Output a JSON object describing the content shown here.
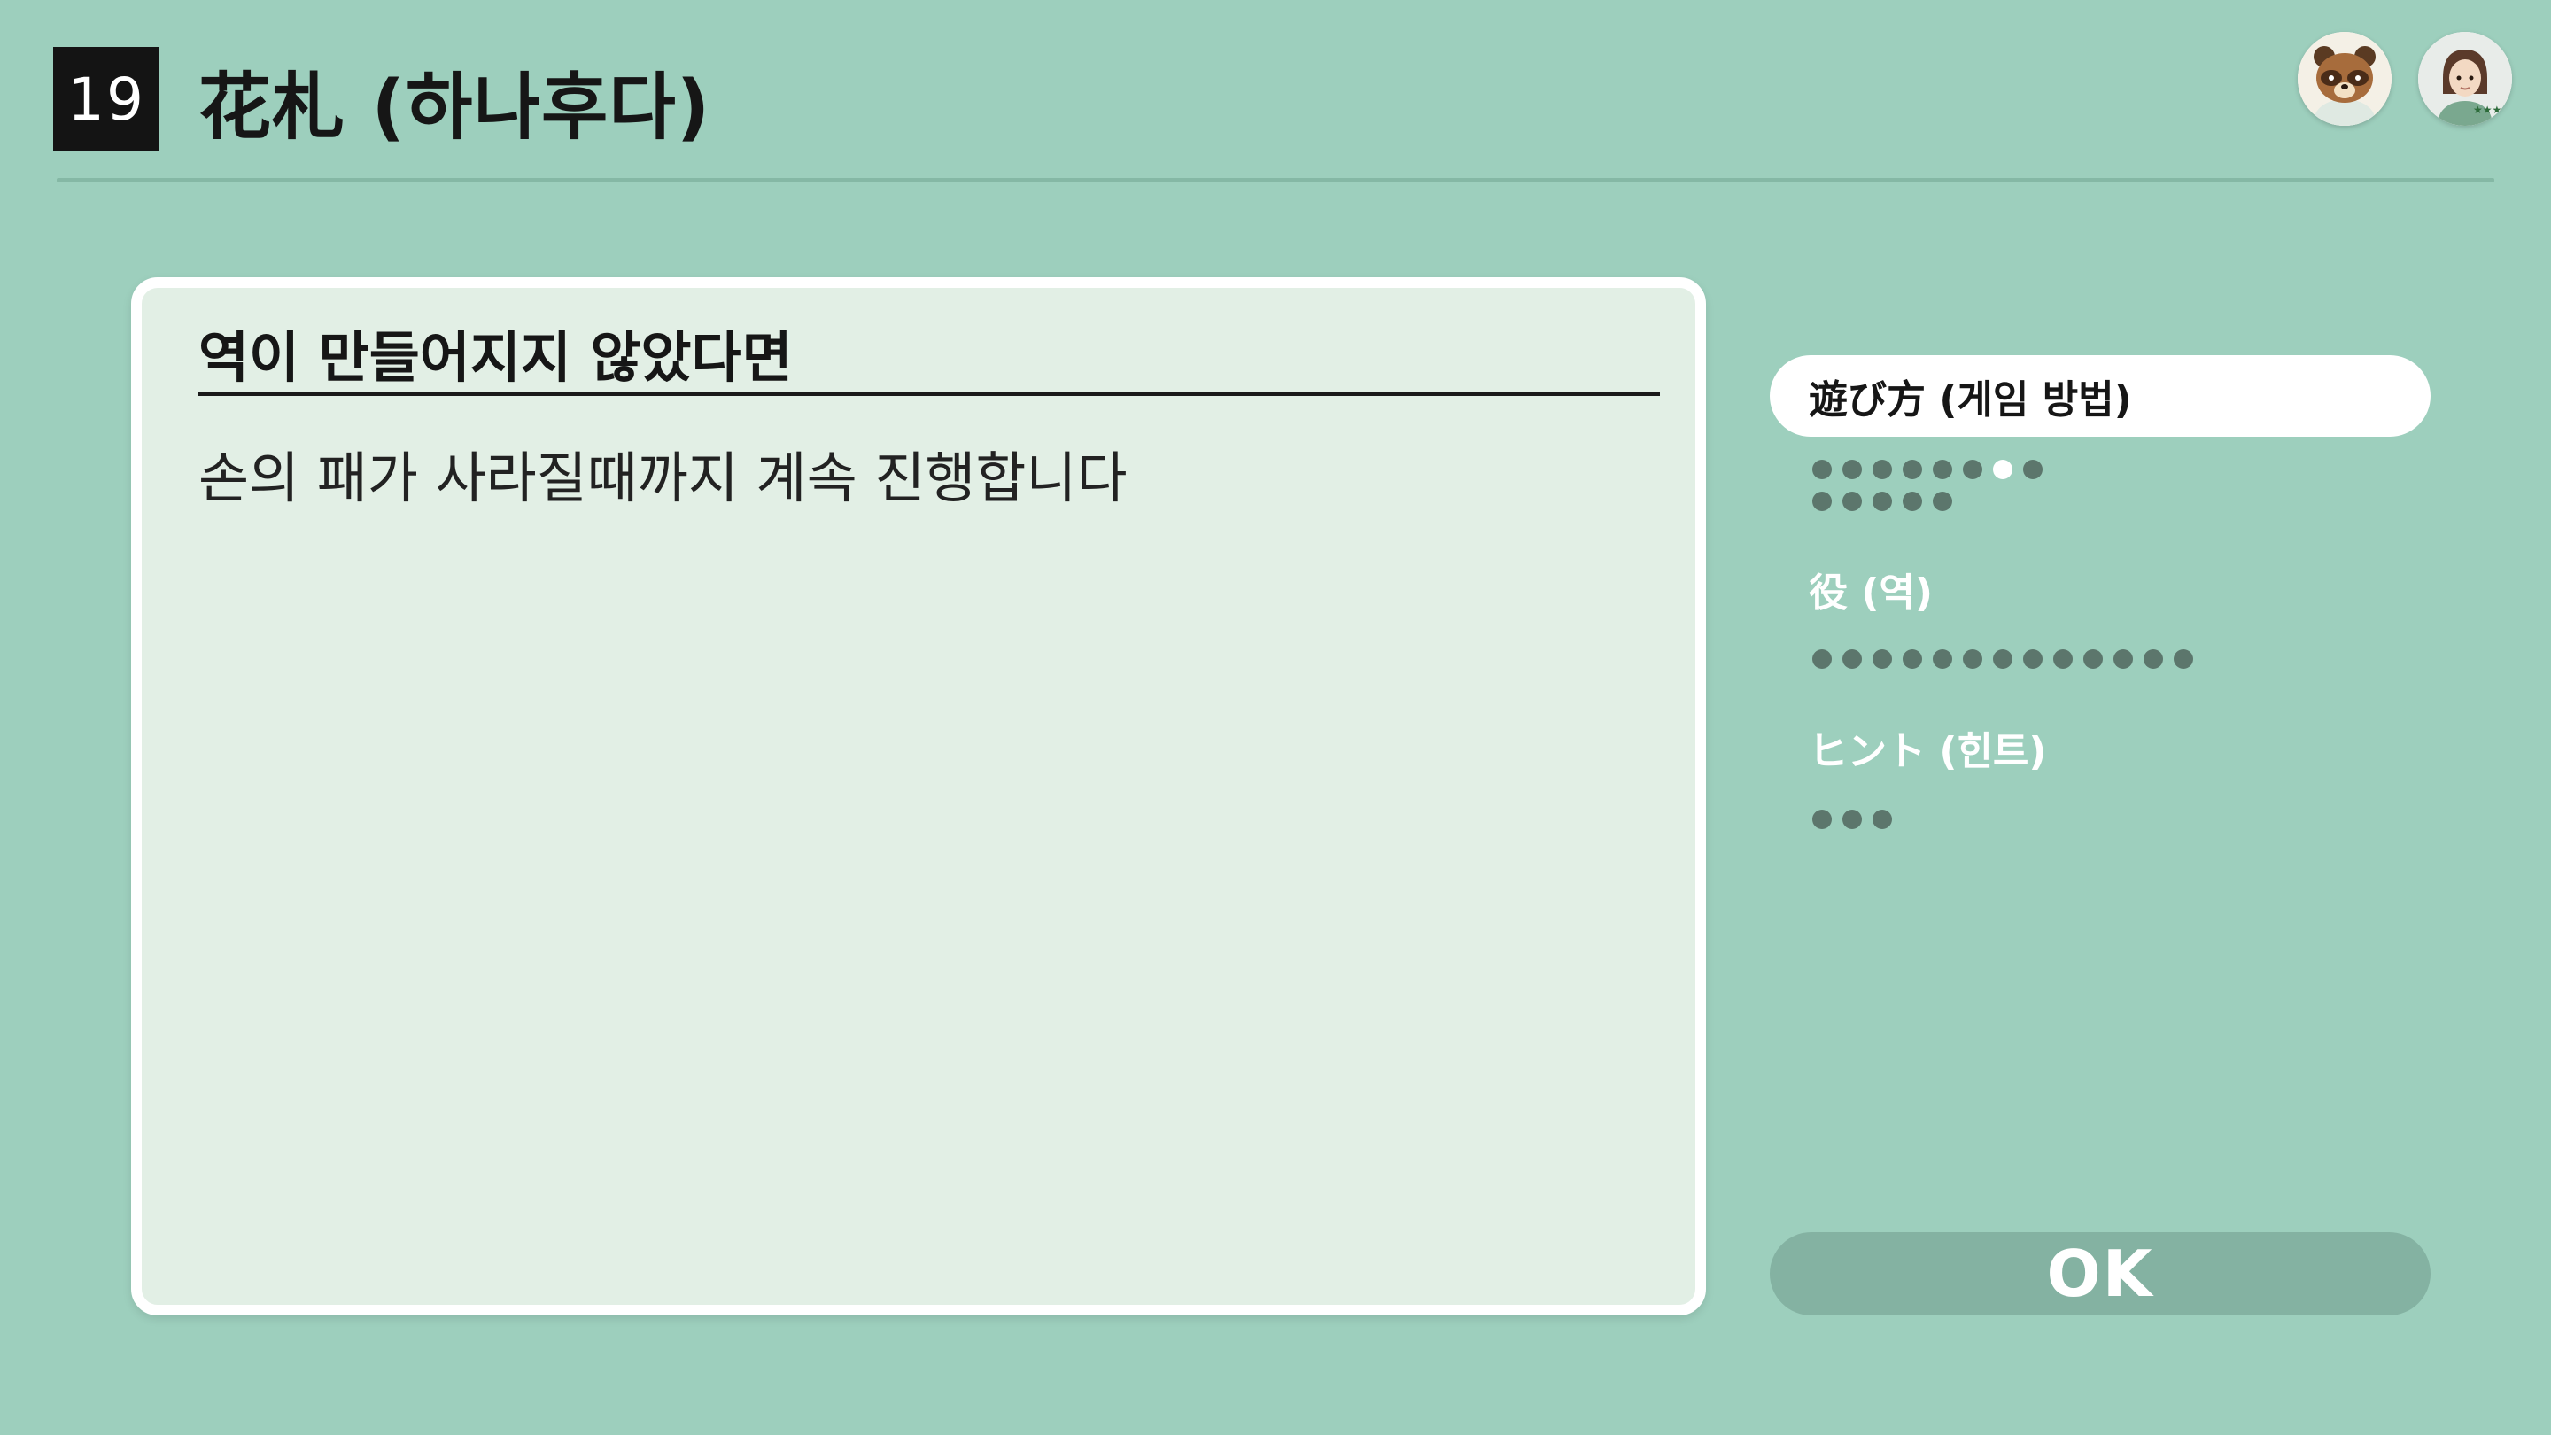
{
  "header": {
    "number": "19",
    "title": "花札 (하나후다)"
  },
  "card": {
    "heading": "역이 만들어지지 않았다면",
    "body": "손의 패가 사라질때까지 계속 진행합니다"
  },
  "sidebar": {
    "items": [
      {
        "label": "遊び方 (게임 방법)",
        "active": true,
        "pages": 13,
        "current_page": 7
      },
      {
        "label": "役 (역)",
        "active": false,
        "pages": 13
      },
      {
        "label": "ヒント (힌트)",
        "active": false,
        "pages": 3
      }
    ]
  },
  "ok_button": {
    "label": "OK"
  },
  "colors": {
    "background": "#9dcfbd",
    "card": "#e2efe5",
    "dot": "#5c766c",
    "ok_button": "#84b2a2"
  },
  "icons": [
    "tanuki-avatar-icon",
    "player-avatar-icon"
  ]
}
